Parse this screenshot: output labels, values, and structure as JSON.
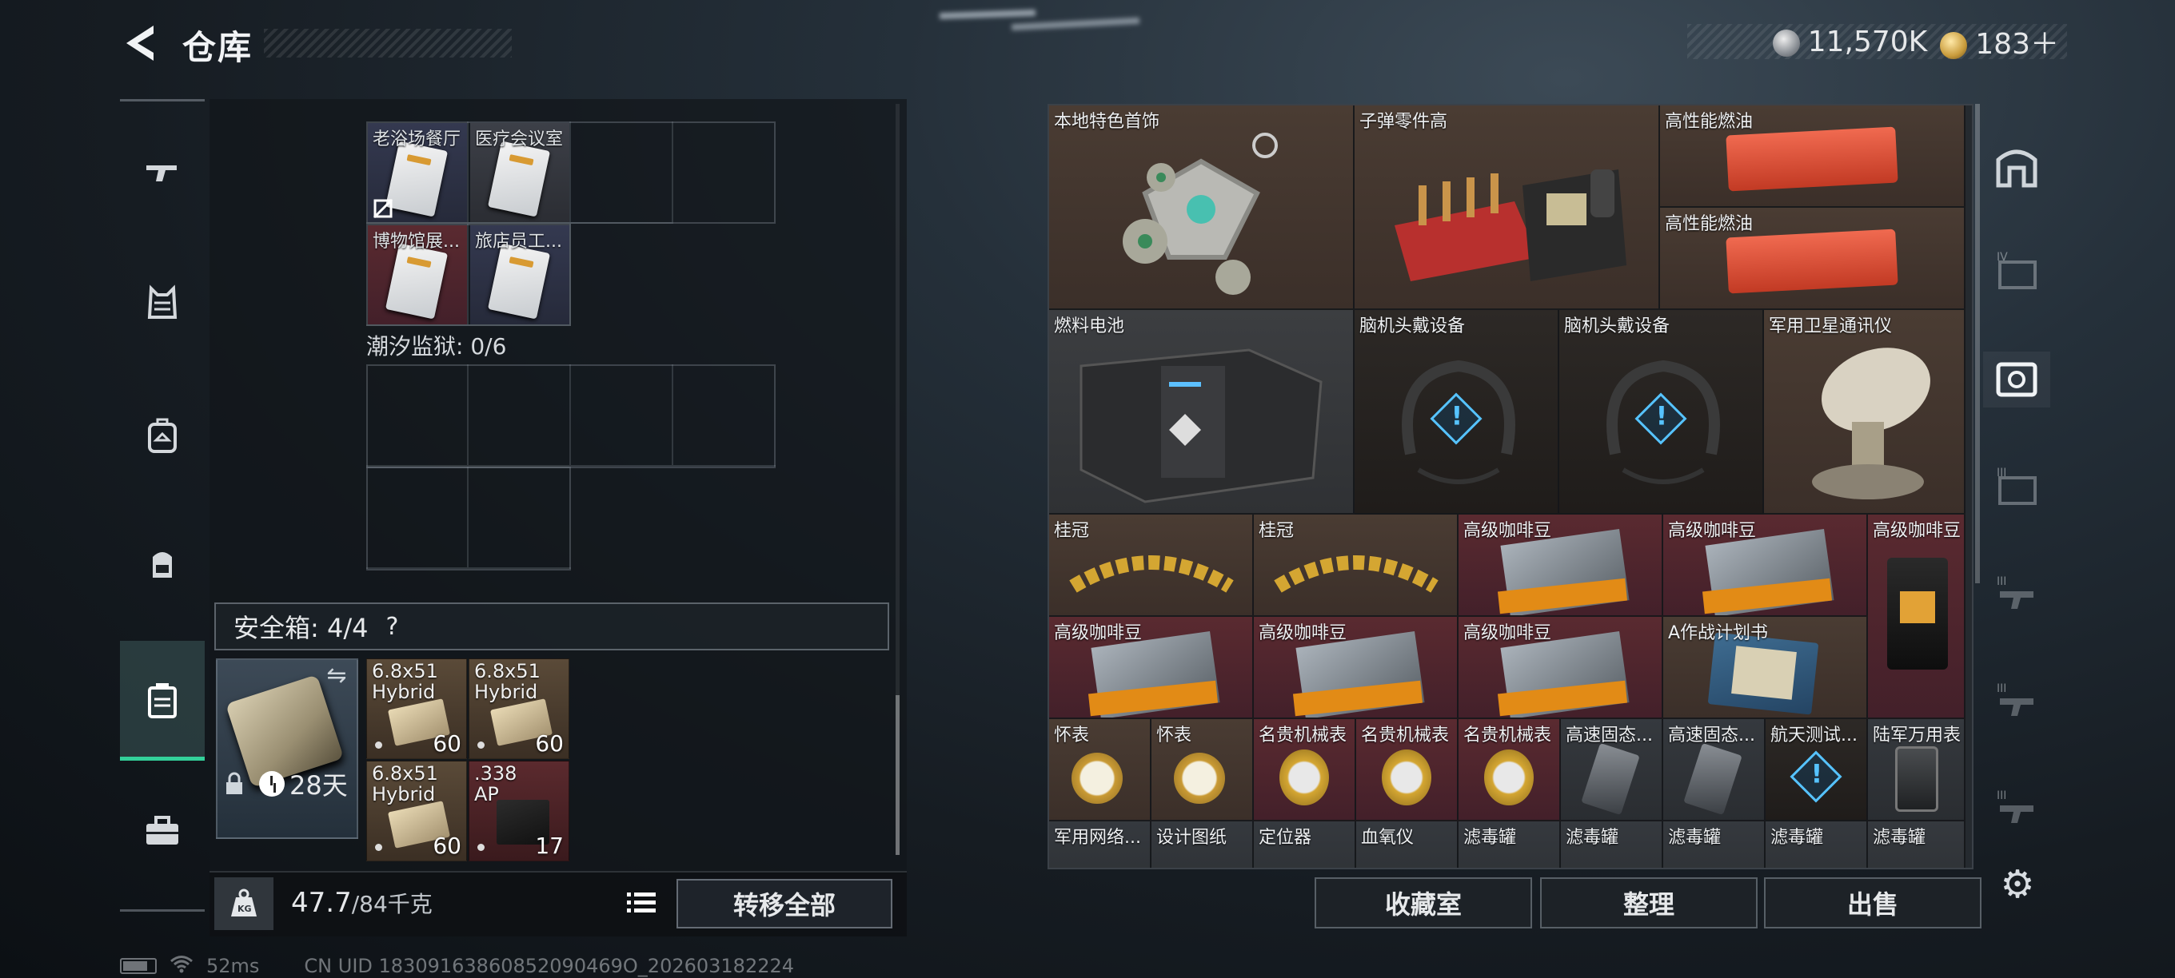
{
  "header": {
    "title": "仓库",
    "silver_amount": "11,570K",
    "gold_amount": "183＋"
  },
  "left_nav": {
    "items": [
      "weapon-icon",
      "armor-icon",
      "backpack-icon",
      "rig-icon",
      "safe-case-icon",
      "toolbox-icon"
    ]
  },
  "collection": {
    "cards": [
      {
        "label": "老浴场餐厅"
      },
      {
        "label": "医疗会议室"
      },
      {
        "label": "博物馆展..."
      },
      {
        "label": "旅店员工..."
      }
    ],
    "tides_label": "潮汐监狱: 0/6"
  },
  "safebox": {
    "label": "安全箱: 4/4",
    "help": "?",
    "timer": "28天",
    "items": [
      {
        "label": "6.8x51\nHybrid",
        "count": "60"
      },
      {
        "label": "6.8x51\nHybrid",
        "count": "60"
      },
      {
        "label": "6.8x51\nHybrid",
        "count": "60"
      },
      {
        "label": ".338\nAP",
        "count": "17"
      }
    ]
  },
  "weight": {
    "current": "47.7",
    "max": "/84千克"
  },
  "transfer_all": "转移全部",
  "stash": {
    "items": [
      "本地特色首饰",
      "子弹零件高",
      "高性能燃油",
      "高性能燃油",
      "燃料电池",
      "脑机头戴设备",
      "脑机头戴设备",
      "军用卫星通讯仪",
      "桂冠",
      "桂冠",
      "高级咖啡豆",
      "高级咖啡豆",
      "高级咖啡豆",
      "高级咖啡豆",
      "高级咖啡豆",
      "高级咖啡豆",
      "A作战计划书",
      "怀表",
      "怀表",
      "名贵机械表",
      "名贵机械表",
      "名贵机械表",
      "高速固态...",
      "高速固态...",
      "航天测试...",
      "陆军万用表",
      "军用网络...",
      "设计图纸",
      "定位器",
      "血氧仪",
      "滤毒罐",
      "滤毒罐",
      "滤毒罐",
      "滤毒罐",
      "滤毒罐"
    ]
  },
  "actions": {
    "collection_room": "收藏室",
    "sort": "整理",
    "sell": "出售"
  },
  "status": {
    "ping": "52ms",
    "uid": "CN UID 18309163860852090469O_202603182224"
  }
}
